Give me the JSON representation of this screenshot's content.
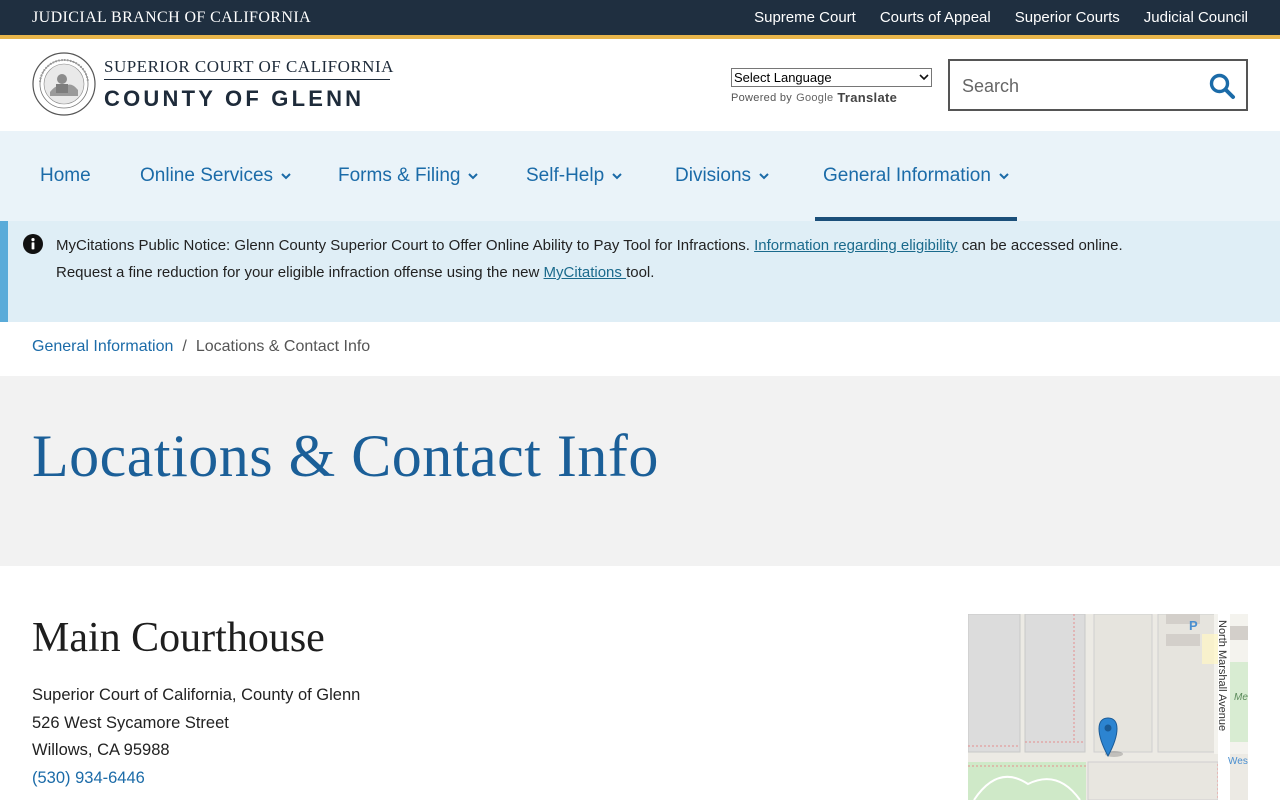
{
  "topbar": {
    "branch": "JUDICIAL BRANCH OF CALIFORNIA",
    "links": [
      "Supreme Court",
      "Courts of Appeal",
      "Superior Courts",
      "Judicial Council"
    ]
  },
  "header": {
    "court_line1": "SUPERIOR COURT OF CALIFORNIA",
    "court_line2": "COUNTY OF GLENN",
    "language_select": "Select Language",
    "powered_by": "Powered by",
    "google": "Google",
    "translate": "Translate",
    "search_placeholder": "Search"
  },
  "nav": {
    "items": [
      {
        "label": "Home"
      },
      {
        "label": "Online Services"
      },
      {
        "label": "Forms & Filing"
      },
      {
        "label": "Self-Help"
      },
      {
        "label": "Divisions"
      },
      {
        "label": "General Information"
      }
    ]
  },
  "notice": {
    "title": "MyCitations Public Notice:",
    "text1": " Glenn County Superior Court to Offer Online Ability to Pay Tool for Infractions. ",
    "link1": "Information regarding eligibility",
    "text2": " can be accessed online.",
    "text3": "Request a fine reduction for your eligible infraction offense using the new ",
    "link2": "MyCitations ",
    "text4": "tool."
  },
  "breadcrumb": {
    "parent": "General Information",
    "separator": "/",
    "current": "Locations & Contact Info"
  },
  "hero": {
    "title": "Locations & Contact Info"
  },
  "location": {
    "heading": "Main Courthouse",
    "line1": "Superior Court of California, County of Glenn",
    "line2": "526 West Sycamore Street",
    "line3": "Willows, CA 95988",
    "phone": "(530) 934-6446"
  },
  "map": {
    "street_label": "North Marshall Avenue",
    "parking": "P",
    "label_me": "Me",
    "label_wes": "Wes"
  },
  "colors": {
    "topbar": "#1f2f40",
    "gold": "#e7b54b",
    "link_blue": "#1b6ba8",
    "nav_bg": "#eaf3f9",
    "notice_bg": "#dfeef6",
    "hero_bg": "#f2f2f2"
  }
}
